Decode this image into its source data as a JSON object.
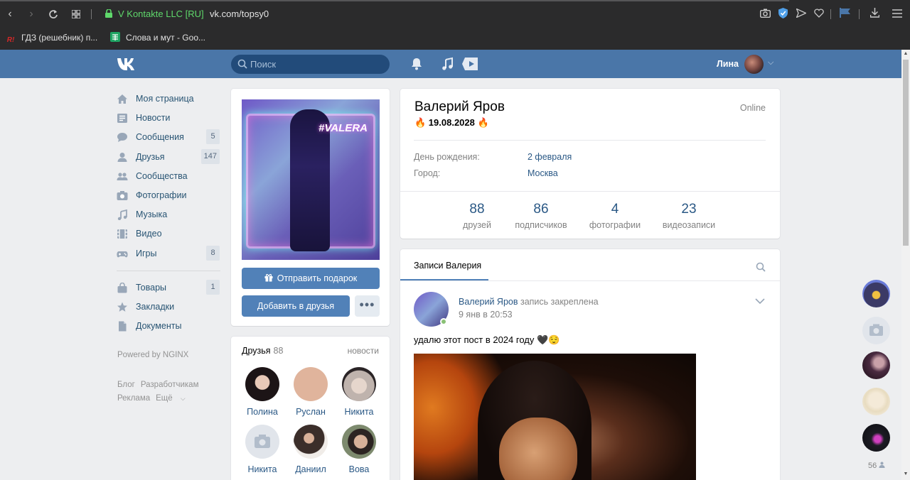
{
  "browser": {
    "site_identity": "V Kontakte LLC [RU]",
    "url": "vk.com/topsy0",
    "bookmarks": [
      {
        "label": "ГДЗ (решебник) п...",
        "icon": "reshak-icon",
        "icon_text": "R!",
        "color": "#d62828"
      },
      {
        "label": "Слова и мут - Goo...",
        "icon": "sheets-icon",
        "color": "#1fa463"
      }
    ]
  },
  "header": {
    "logo": "vk",
    "search_placeholder": "Поиск",
    "user_name": "Лина"
  },
  "menu": {
    "items": [
      {
        "label": "Моя страница",
        "icon": "home-icon",
        "count": ""
      },
      {
        "label": "Новости",
        "icon": "news-icon",
        "count": ""
      },
      {
        "label": "Сообщения",
        "icon": "messages-icon",
        "count": "5"
      },
      {
        "label": "Друзья",
        "icon": "friends-icon",
        "count": "147"
      },
      {
        "label": "Сообщества",
        "icon": "groups-icon",
        "count": ""
      },
      {
        "label": "Фотографии",
        "icon": "camera-icon",
        "count": ""
      },
      {
        "label": "Музыка",
        "icon": "music-icon",
        "count": ""
      },
      {
        "label": "Видео",
        "icon": "video-icon",
        "count": ""
      },
      {
        "label": "Игры",
        "icon": "games-icon",
        "count": "8"
      }
    ],
    "items2": [
      {
        "label": "Товары",
        "icon": "goods-icon",
        "count": "1"
      },
      {
        "label": "Закладки",
        "icon": "bookmarks-icon",
        "count": ""
      },
      {
        "label": "Документы",
        "icon": "documents-icon",
        "count": ""
      }
    ],
    "powered": "Powered by NGINX",
    "footer": [
      "Блог",
      "Разработчикам",
      "Реклама",
      "Ещё"
    ]
  },
  "profile_photo": {
    "overlay_text": "#VALERA"
  },
  "actions": {
    "gift": "Отправить подарок",
    "add_friend": "Добавить в друзья",
    "more": "•••"
  },
  "friends": {
    "title": "Друзья",
    "count": "88",
    "news_link": "новости",
    "list": [
      {
        "name": "Полина"
      },
      {
        "name": "Руслан"
      },
      {
        "name": "Никита"
      },
      {
        "name": "Никита"
      },
      {
        "name": "Даниил"
      },
      {
        "name": "Вова"
      }
    ]
  },
  "profile": {
    "name": "Валерий Яров",
    "status": "🔥 19.08.2028 🔥",
    "online": "Online",
    "info": [
      {
        "label": "День рождения:",
        "value": "2 февраля"
      },
      {
        "label": "Город:",
        "value": "Москва"
      }
    ],
    "stats": [
      {
        "num": "88",
        "cap": "друзей"
      },
      {
        "num": "86",
        "cap": "подписчиков"
      },
      {
        "num": "4",
        "cap": "фотографии"
      },
      {
        "num": "23",
        "cap": "видеозаписи"
      }
    ]
  },
  "wall": {
    "tab": "Записи Валерия",
    "post": {
      "author": "Валерий Яров",
      "action": "запись закреплена",
      "date": "9 янв в 20:53",
      "text": "удалю этот пост в 2024 году 🖤😌"
    }
  },
  "dock": {
    "count": "56"
  }
}
